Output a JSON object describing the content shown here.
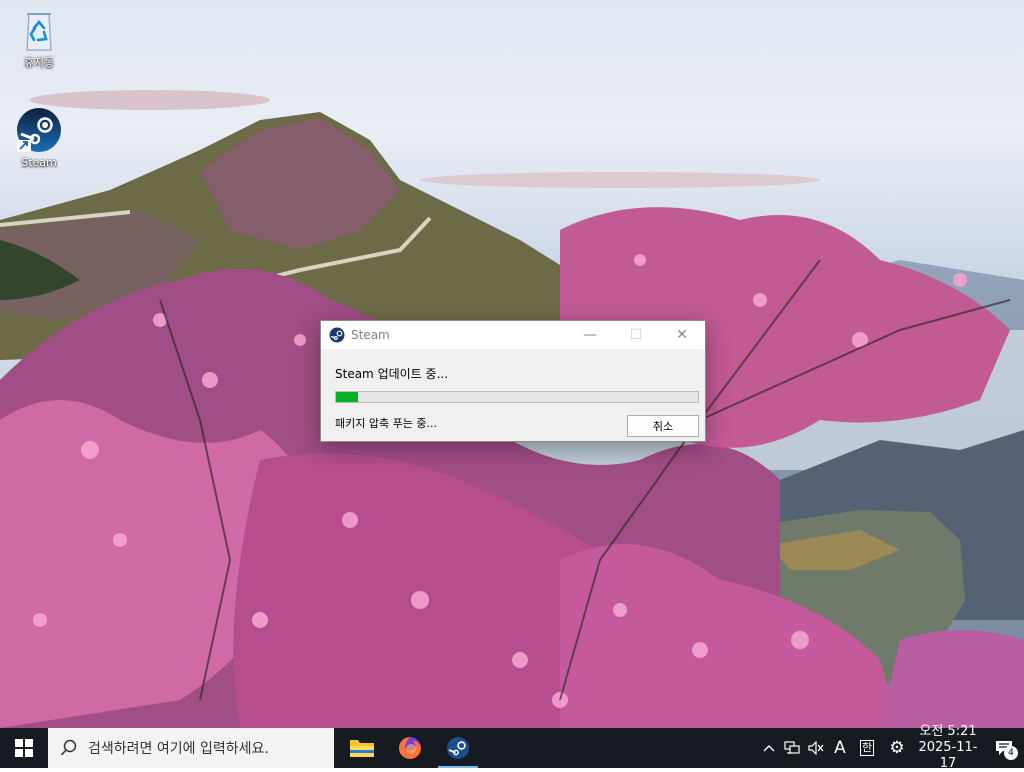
{
  "desktop": {
    "icons": [
      {
        "label": "휴지통",
        "icon": "recycle-bin-icon"
      },
      {
        "label": "Steam",
        "icon": "steam-icon"
      }
    ]
  },
  "dialog": {
    "title": "Steam",
    "status": "Steam 업데이트 중...",
    "substatus": "패키지 압축 푸는 중...",
    "progress_percent": 6,
    "cancel_label": "취소",
    "controls": {
      "minimize": "—",
      "maximize": "☐",
      "close": "✕"
    }
  },
  "taskbar": {
    "search_placeholder": "검색하려면 여기에 입력하세요.",
    "pinned": [
      "file-explorer-icon",
      "firefox-icon",
      "steam-icon"
    ],
    "tray": {
      "ime_mode": "A",
      "ime_lang": "한",
      "time": "오전 5:21",
      "date": "2025-11-17",
      "notification_count": "4"
    }
  },
  "colors": {
    "progress_fill": "#06b025",
    "taskbar_bg": "#161b22",
    "accent": "#76b9ed"
  }
}
